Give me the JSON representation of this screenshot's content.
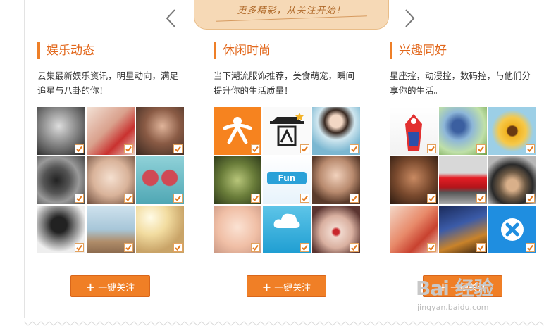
{
  "banner": {
    "text": "更多精彩，从关注开始！"
  },
  "columns": [
    {
      "title": "娱乐动态",
      "desc": "云集最新娱乐资讯，明星动向，满足追星与八卦的你！",
      "button": "一键关注",
      "tiles": [
        "portrait-man-bw",
        "woman-red-dress",
        "woman-dark-hair",
        "photographer-camera",
        "woman-smile",
        "heart-sunglasses",
        "curly-hair-girl",
        "ice-age-squirrel",
        "sunlight-girl"
      ]
    },
    {
      "title": "休闲时尚",
      "desc": "当下潮流服饰推荐，美食萌宠，瞬间提升你的生活质量！",
      "button": "一键关注",
      "tiles": [
        "orange-logo",
        "black-hat-logo",
        "girl-blue-dress",
        "green-heart-design",
        "fun-logo",
        "woman-long-hair",
        "baby-face",
        "life-logo",
        "red-lips-woman"
      ]
    },
    {
      "title": "兴趣同好",
      "desc": "星座控，动漫控，数码控，与他们分享你的生活。",
      "button": "一键关注",
      "tiles": [
        "mascot-figure",
        "anime-character",
        "sunflower",
        "muscle-man",
        "red-sports-car",
        "man-hat",
        "poster-red",
        "dnf-game",
        "blue-app-logo"
      ]
    }
  ],
  "watermark": {
    "main": "Bai 经验",
    "sub": "jingyan.baidu.com"
  },
  "colors": {
    "accent": "#f07f26",
    "title": "#e2671b",
    "banner": "#f6d9b6"
  }
}
